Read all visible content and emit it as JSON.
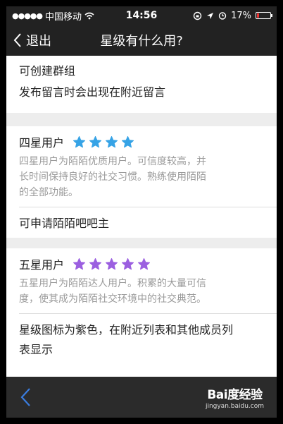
{
  "status": {
    "carrier": "中国移动",
    "time": "14:56",
    "battery": "17%",
    "battery_level": 0.17,
    "icons": [
      "signal-dots-icon",
      "wifi-icon",
      "rotation-lock-icon",
      "location-icon",
      "alarm-icon",
      "battery-icon"
    ]
  },
  "nav": {
    "back_label": "退出",
    "title": "星级有什么用?"
  },
  "top_card": {
    "lines": [
      "可创建群组",
      "发布留言时会出现在附近留言"
    ]
  },
  "four_star": {
    "name": "四星用户",
    "star_count": 4,
    "star_color": "#36a3e6",
    "desc_lines": [
      "四星用户为陌陌优质用户。可信度较高，并",
      "长时间保持良好的社交习惯。熟练使用陌陌",
      "的全部功能。"
    ],
    "extra_lines": [
      "可申请陌陌吧吧主"
    ]
  },
  "five_star": {
    "name": "五星用户",
    "star_count": 5,
    "star_color": "#9b5fe0",
    "desc_lines": [
      "五星用户为陌陌达人用户。积累的大量可信",
      "度，使其成为陌陌社交环境中的社交典范。"
    ],
    "extra_lines": [
      "星级图标为紫色，在附近列表和其他成员列",
      "表显示"
    ]
  },
  "watermark": {
    "logo": "Bai度经验",
    "url": "jingyan.baidu.com"
  },
  "colors": {
    "bar_bg": "#222222",
    "accent_blue": "#3a7de0"
  }
}
